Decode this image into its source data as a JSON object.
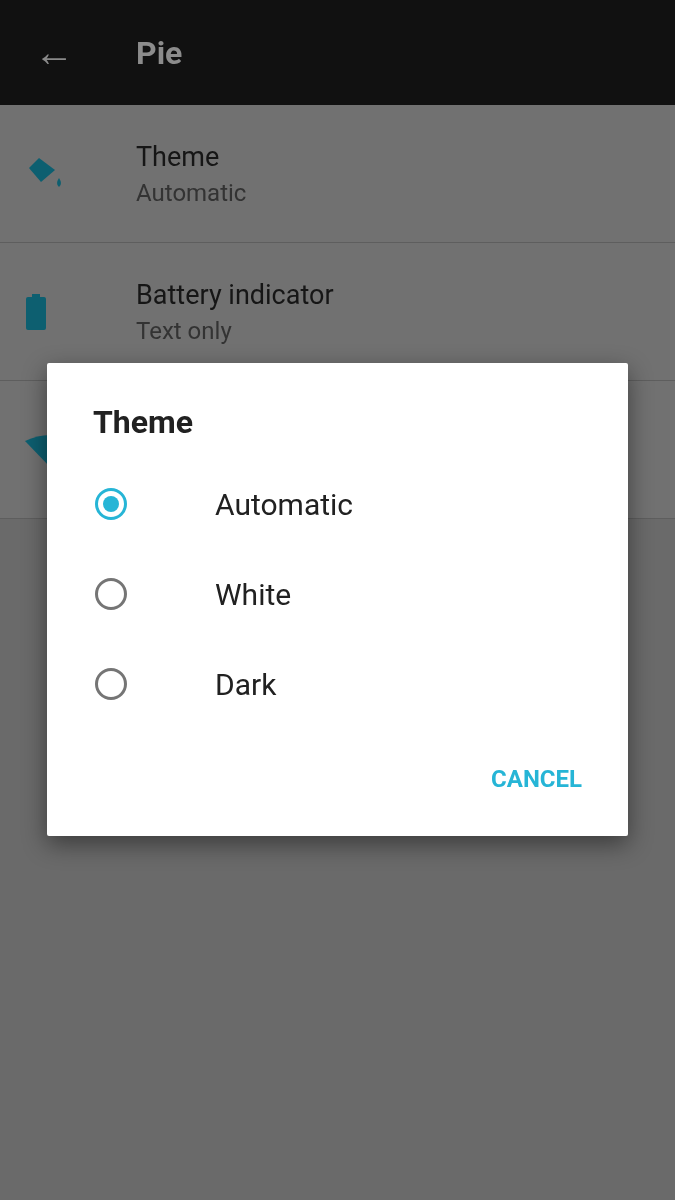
{
  "app_bar": {
    "back_icon": "←",
    "title": "Pie"
  },
  "settings": [
    {
      "kind": "paint",
      "title": "Theme",
      "summary": "Automatic"
    },
    {
      "kind": "battery",
      "title": "Battery indicator",
      "summary": "Text only"
    },
    {
      "kind": "signal"
    }
  ],
  "dialog": {
    "title": "Theme",
    "options": [
      {
        "label": "Automatic",
        "selected": true
      },
      {
        "label": "White",
        "selected": false
      },
      {
        "label": "Dark",
        "selected": false
      }
    ],
    "buttons": [
      "CANCEL"
    ]
  }
}
